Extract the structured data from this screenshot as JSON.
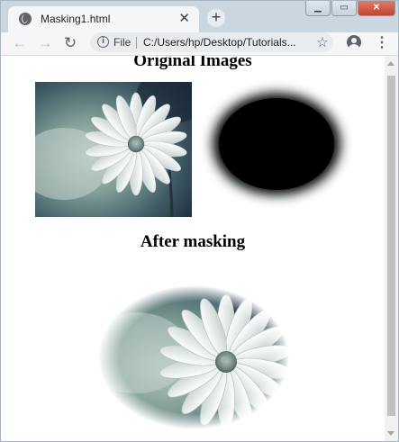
{
  "browser": {
    "tab_title": "Masking1.html",
    "tab_close_glyph": "✕",
    "new_tab_glyph": "+",
    "window_controls": {
      "minimize": "▁",
      "restore": "▭",
      "close": "✕"
    },
    "nav": {
      "back": "←",
      "forward": "→",
      "reload": "↻"
    },
    "address_bar": {
      "info_glyph": "i",
      "scheme": "File",
      "url": "C:/Users/hp/Desktop/Tutorials..."
    },
    "star_glyph": "☆",
    "menu_glyph": "⋮",
    "icons": {
      "favicon": "globe-icon",
      "info": "info-icon",
      "bookmark": "star-icon",
      "profile": "account-circle-icon",
      "menu": "kebab-menu-icon"
    }
  },
  "page": {
    "heading_original": "Original Images",
    "heading_after": "After masking",
    "images": {
      "original": "daisy flower photo",
      "mask": "black ellipse with blurred edge",
      "masked": "daisy photo masked by blurred ellipse"
    }
  },
  "colors": {
    "tab_strip": "#cad6e0",
    "toolbar": "#f4f6f8",
    "mask_fill": "#000000",
    "photo_bg": "#3c5a66",
    "petal": "#f4f7f6"
  }
}
